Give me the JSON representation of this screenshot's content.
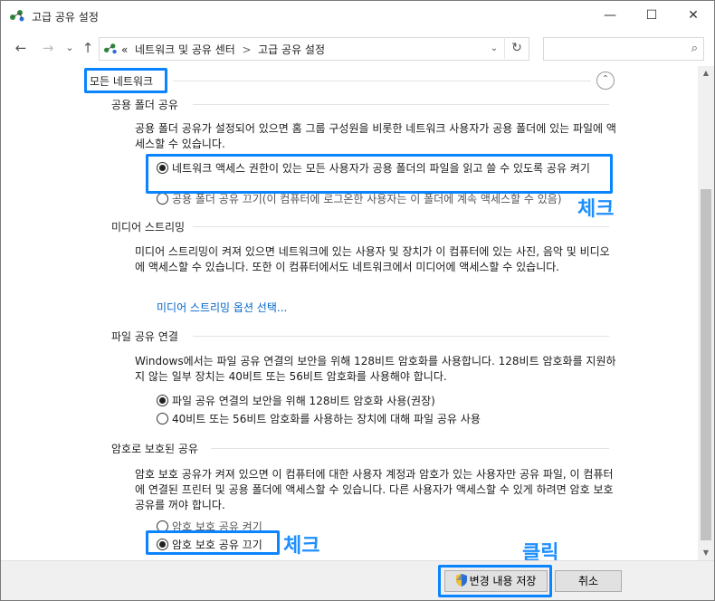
{
  "window": {
    "title": "고급 공유 설정",
    "minimize_symbol": "—",
    "maximize_symbol": "☐",
    "close_symbol": "✕"
  },
  "nav": {
    "back_symbol": "←",
    "forward_symbol": "→",
    "recent_symbol": "⌄",
    "up_symbol": "↑",
    "breadcrumb_prefix": "«",
    "breadcrumbs": [
      "네트워크 및 공유 센터",
      "고급 공유 설정"
    ],
    "crumb_separator": ">",
    "dropdown_symbol": "⌄",
    "refresh_symbol": "↻",
    "search_placeholder": "",
    "search_symbol": "⌕"
  },
  "profile": {
    "title": "모든 네트워크",
    "collapse_symbol": "⌃"
  },
  "sections": {
    "public_folder": {
      "title": "공용 폴더 공유",
      "desc": "공용 폴더 공유가 설정되어 있으면 홈 그룹 구성원을 비롯한 네트워크 사용자가 공용 폴더에 있는 파일에 액세스할 수 있습니다.",
      "option_on": "네트워크 액세스 권한이 있는 모든 사용자가 공용 폴더의 파일을 읽고 쓸 수 있도록 공유 켜기",
      "option_off": "공용 폴더 공유 끄기(이 컴퓨터에 로그온한 사용자는 이 폴더에 계속 액세스할 수 있음)"
    },
    "media": {
      "title": "미디어 스트리밍",
      "desc": "미디어 스트리밍이 켜져 있으면 네트워크에 있는 사용자 및 장치가 이 컴퓨터에 있는 사진, 음악 및 비디오에 액세스할 수 있습니다. 또한 이 컴퓨터에서도 네트워크에서 미디어에 액세스할 수 있습니다.",
      "link": "미디어 스트리밍 옵션 선택..."
    },
    "file_sharing": {
      "title": "파일 공유 연결",
      "desc": "Windows에서는 파일 공유 연결의 보안을 위해 128비트 암호화를 사용합니다. 128비트 암호화를 지원하지 않는 일부 장치는 40비트 또는 56비트 암호화를 사용해야 합니다.",
      "option_128": "파일 공유 연결의 보안을 위해 128비트 암호화 사용(권장)",
      "option_40_56": "40비트 또는 56비트 암호화를 사용하는 장치에 대해 파일 공유 사용"
    },
    "password": {
      "title": "암호로 보호된 공유",
      "desc": "암호 보호 공유가 켜져 있으면 이 컴퓨터에 대한 사용자 계정과 암호가 있는 사용자만 공유 파일, 이 컴퓨터에 연결된 프린터 및 공용 폴더에 액세스할 수 있습니다. 다른 사용자가 액세스할 수 있게 하려면 암호 보호 공유를 꺼야 합니다.",
      "option_on": "암호 보호 공유 켜기",
      "option_off": "암호 보호 공유 끄기"
    }
  },
  "annotations": {
    "check1": "체크",
    "check2": "체크",
    "click": "클릭"
  },
  "footer": {
    "save": "변경 내용 저장",
    "cancel": "취소"
  },
  "colors": {
    "highlight": "#0a84ff",
    "annotation": "#1e8fff",
    "link": "#0066cc"
  }
}
